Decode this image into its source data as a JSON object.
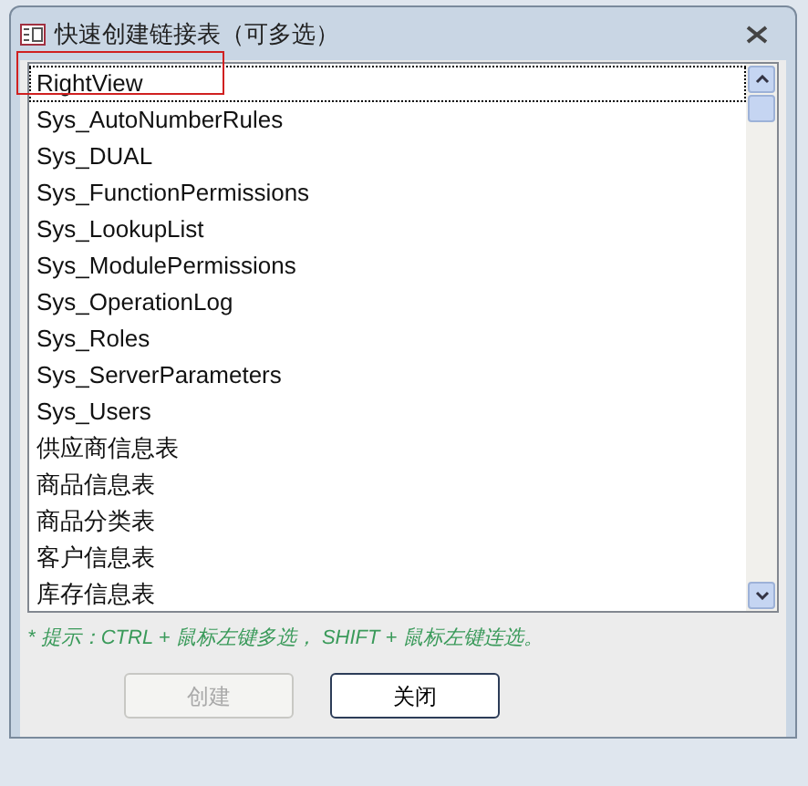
{
  "window": {
    "title": "快速创建链接表（可多选）"
  },
  "list": {
    "items": [
      {
        "label": "RightView",
        "focused": true
      },
      {
        "label": "Sys_AutoNumberRules",
        "focused": false
      },
      {
        "label": "Sys_DUAL",
        "focused": false
      },
      {
        "label": "Sys_FunctionPermissions",
        "focused": false
      },
      {
        "label": "Sys_LookupList",
        "focused": false
      },
      {
        "label": "Sys_ModulePermissions",
        "focused": false
      },
      {
        "label": "Sys_OperationLog",
        "focused": false
      },
      {
        "label": "Sys_Roles",
        "focused": false
      },
      {
        "label": "Sys_ServerParameters",
        "focused": false
      },
      {
        "label": "Sys_Users",
        "focused": false
      },
      {
        "label": "供应商信息表",
        "focused": false
      },
      {
        "label": "商品信息表",
        "focused": false
      },
      {
        "label": "商品分类表",
        "focused": false
      },
      {
        "label": "客户信息表",
        "focused": false
      },
      {
        "label": "库存信息表",
        "focused": false
      }
    ]
  },
  "hint": "* 提示：CTRL + 鼠标左键多选， SHIFT + 鼠标左键连选。",
  "buttons": [
    {
      "label": "创建",
      "disabled": true
    },
    {
      "label": "关闭",
      "disabled": false
    }
  ]
}
